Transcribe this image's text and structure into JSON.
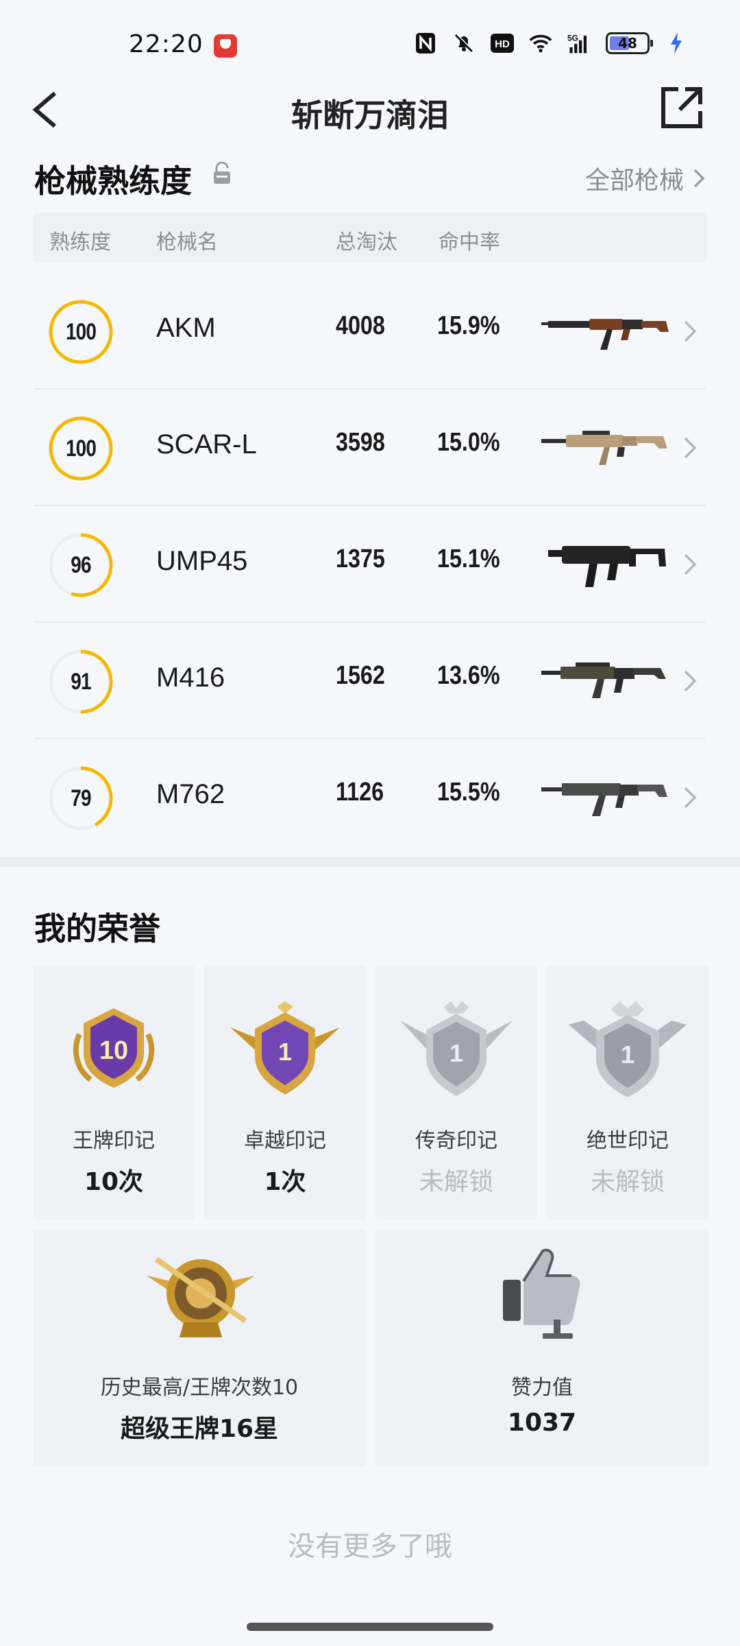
{
  "status_bar": {
    "time": "22:20",
    "battery": "48",
    "network": "5G",
    "hd": "HD"
  },
  "header": {
    "title": "斩断万滴泪",
    "back_icon": "back-arrow-icon",
    "share_icon": "share-icon"
  },
  "weapons": {
    "title": "枪械熟练度",
    "all_link": "全部枪械",
    "columns": [
      "熟练度",
      "枪械名",
      "总淘汰",
      "命中率"
    ],
    "rows": [
      {
        "level": "100",
        "progress": 1.0,
        "name": "AKM",
        "kills": "4008",
        "hit_rate": "15.9%",
        "icon": "akm-rifle-icon"
      },
      {
        "level": "100",
        "progress": 1.0,
        "name": "SCAR-L",
        "kills": "3598",
        "hit_rate": "15.0%",
        "icon": "scar-l-rifle-icon"
      },
      {
        "level": "96",
        "progress": 0.55,
        "name": "UMP45",
        "kills": "1375",
        "hit_rate": "15.1%",
        "icon": "ump45-smg-icon"
      },
      {
        "level": "91",
        "progress": 0.5,
        "name": "M416",
        "kills": "1562",
        "hit_rate": "13.6%",
        "icon": "m416-rifle-icon"
      },
      {
        "level": "79",
        "progress": 0.42,
        "name": "M762",
        "kills": "1126",
        "hit_rate": "15.5%",
        "icon": "m762-rifle-icon"
      }
    ]
  },
  "honors": {
    "title": "我的荣誉",
    "cards": [
      {
        "label": "王牌印记",
        "value": "10次",
        "badge_text": "10",
        "locked": false
      },
      {
        "label": "卓越印记",
        "value": "1次",
        "badge_text": "1",
        "locked": false
      },
      {
        "label": "传奇印记",
        "value": "未解锁",
        "badge_text": "1",
        "locked": true
      },
      {
        "label": "绝世印记",
        "value": "未解锁",
        "badge_text": "1",
        "locked": true
      }
    ],
    "wide_cards": [
      {
        "label": "历史最高/王牌次数10",
        "value": "超级王牌16星",
        "icon": "ace-emblem-icon"
      },
      {
        "label": "赞力值",
        "value": "1037",
        "icon": "thumbs-up-icon"
      }
    ]
  },
  "footer": {
    "text": "没有更多了哦"
  },
  "colors": {
    "ring": "#f5b800",
    "ring_track": "#eceef2",
    "gold": "#c9962e",
    "purple": "#6a3aa8",
    "silver": "#b9bcc4"
  }
}
